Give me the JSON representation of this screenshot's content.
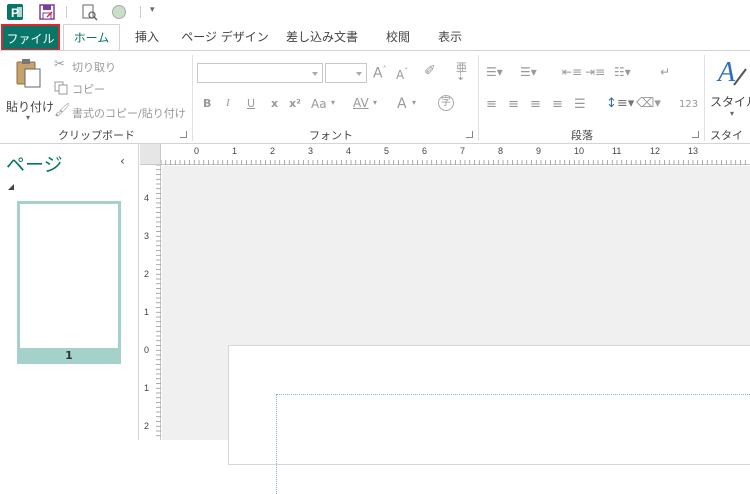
{
  "quick_access": {
    "icons": [
      "publisher-logo-icon",
      "save-icon",
      "print-preview-icon",
      "circle-icon",
      "customize-qat-icon"
    ]
  },
  "tabs": [
    "ファイル",
    "ホーム",
    "挿入",
    "ページ デザイン",
    "差し込み文書",
    "校閲",
    "表示"
  ],
  "ribbon": {
    "clipboard": {
      "paste_label": "貼り付け",
      "cut_label": "切り取り",
      "copy_label": "コピー",
      "format_painter_label": "書式のコピー/貼り付け",
      "group_label": "クリップボード"
    },
    "font": {
      "group_label": "フォント",
      "bold": "B",
      "italic": "I",
      "underline": "U",
      "strike": "x",
      "superscript": "x²",
      "change_case": "Aa",
      "char_spacing": "AV",
      "font_color": "A"
    },
    "paragraph": {
      "group_label": "段落",
      "numbers": "123"
    },
    "styles": {
      "label": "スタイル",
      "group_label": "スタイル"
    }
  },
  "nav_pane": {
    "title": "ページ",
    "collapse": "‹",
    "page_number": "1"
  },
  "rulers": {
    "h_labels": [
      "1",
      "0",
      "1",
      "2",
      "3",
      "4",
      "5",
      "6",
      "7",
      "8",
      "9",
      "10",
      "11",
      "12",
      "13"
    ],
    "v_labels": [
      "4",
      "3",
      "2",
      "1",
      "0",
      "1",
      "2"
    ]
  },
  "colors": {
    "accent": "#077568",
    "thumb": "#a4d1ca",
    "highlight_border": "#e3262c"
  }
}
